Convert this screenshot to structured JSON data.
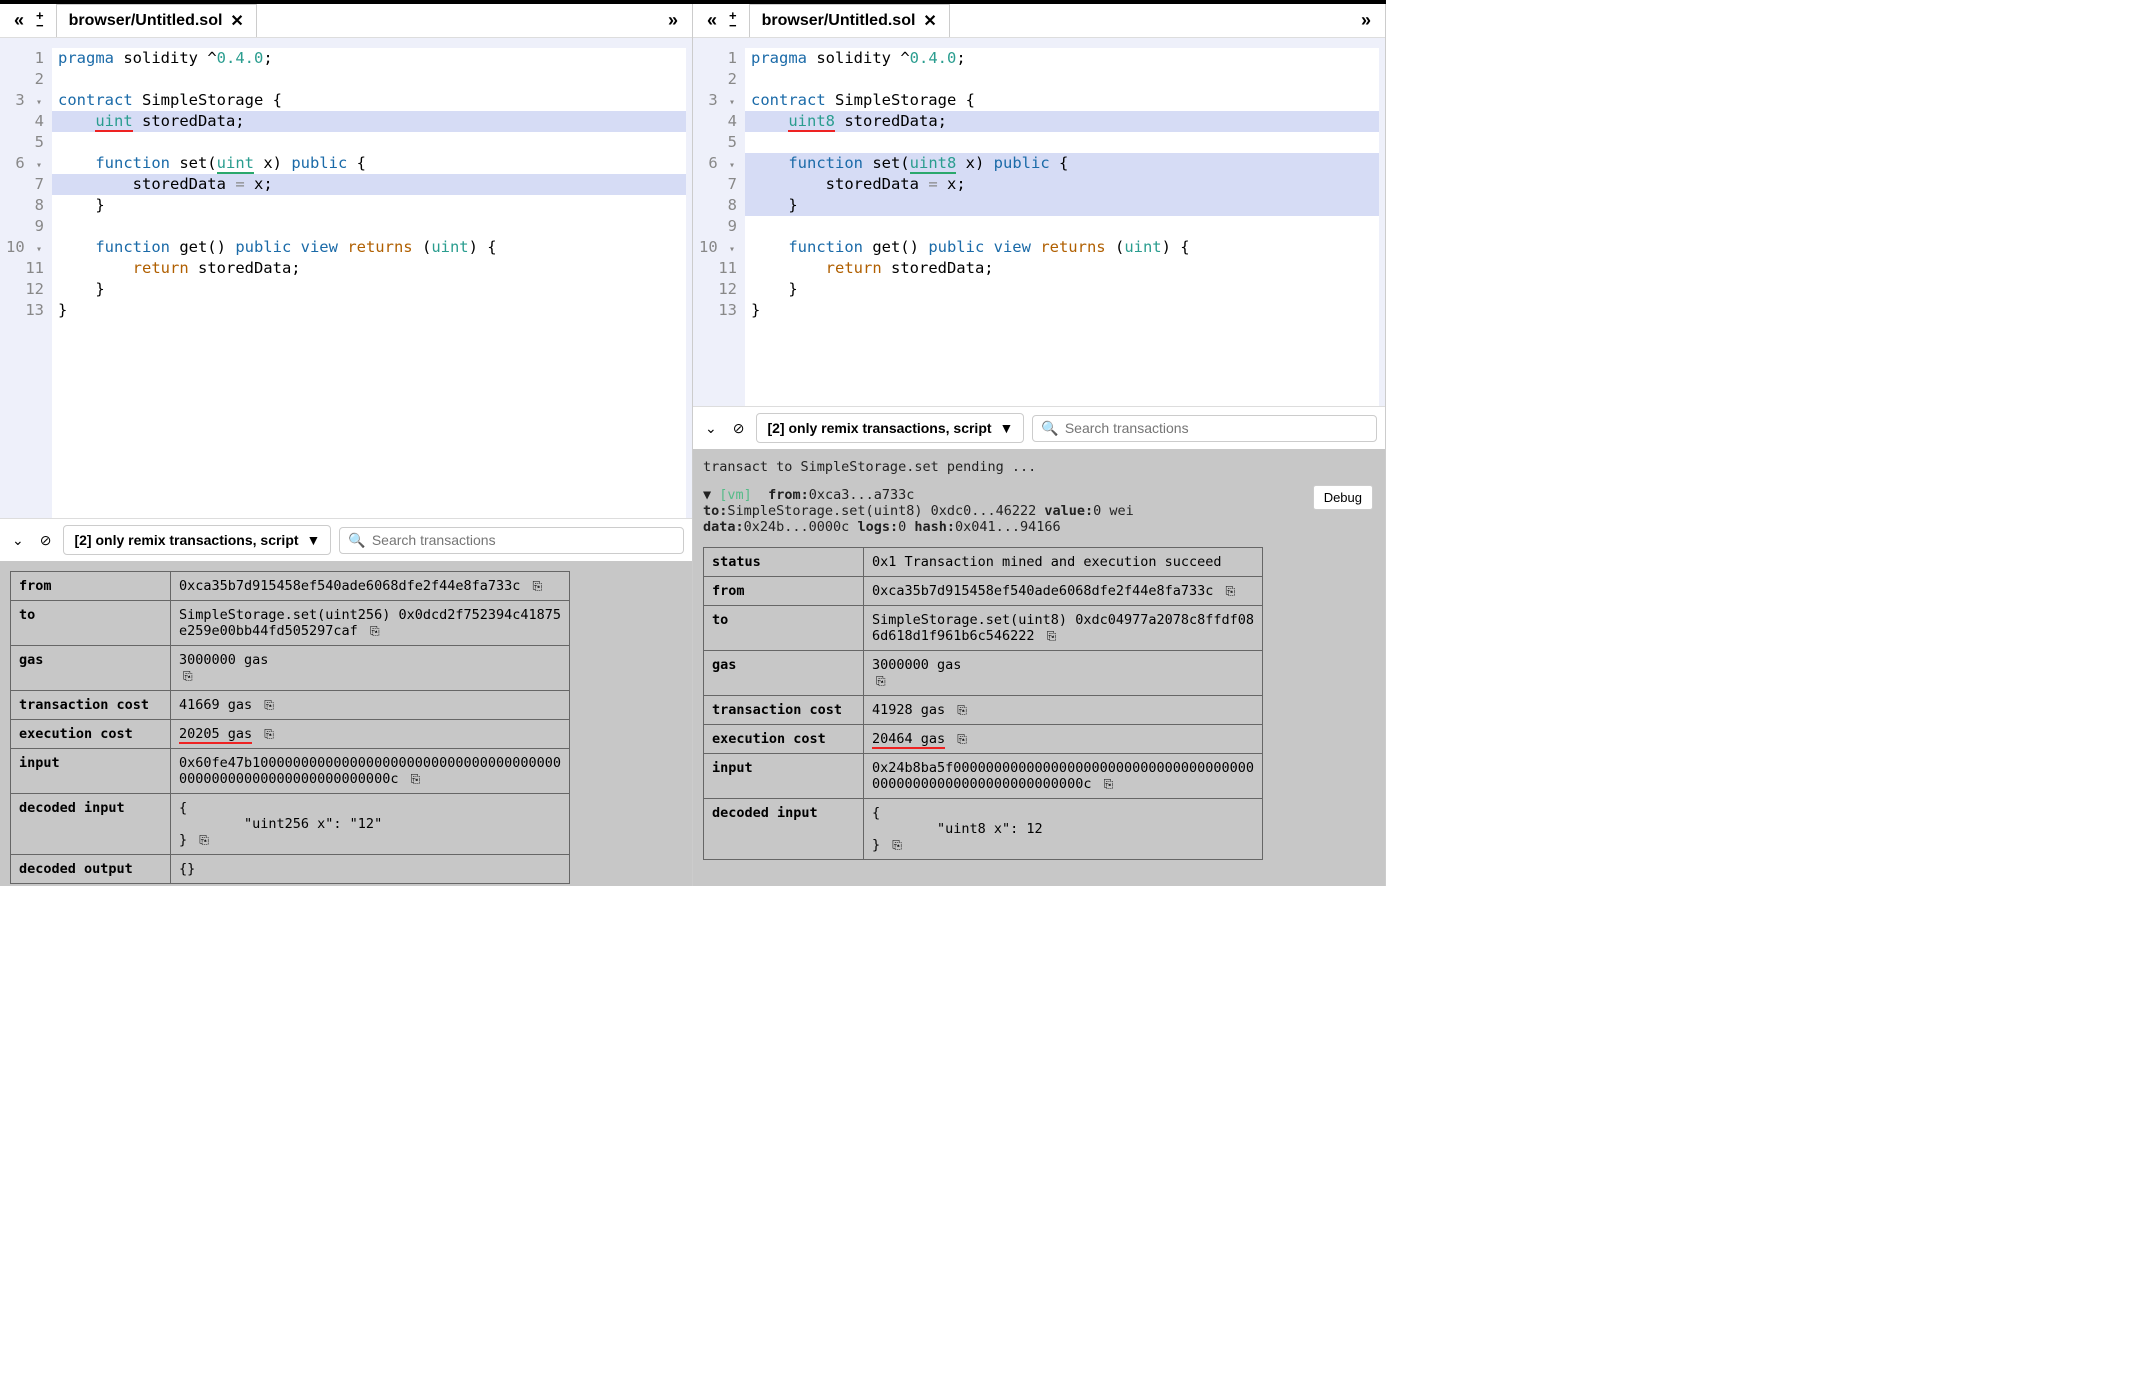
{
  "left": {
    "tabs": {
      "title": "browser/Untitled.sol"
    },
    "code": {
      "l1_a": "pragma",
      "l1_b": " solidity ^",
      "l1_c": "0.4.0",
      "l1_d": ";",
      "l3_a": "contract",
      "l3_b": " SimpleStorage {",
      "l4_a": "    ",
      "l4_b": "uint",
      "l4_c": " storedData;",
      "l6_a": "    ",
      "l6_b": "function",
      "l6_c": " set(",
      "l6_d": "uint",
      "l6_e": " x) ",
      "l6_f": "public",
      "l6_g": " {",
      "l7_a": "        storedData ",
      "l7_b": "=",
      "l7_c": " x;",
      "l8": "    }",
      "l10_a": "    ",
      "l10_b": "function",
      "l10_c": " get() ",
      "l10_d": "public view",
      "l10_e": " ",
      "l10_f": "returns",
      "l10_g": " (",
      "l10_h": "uint",
      "l10_i": ") {",
      "l11_a": "        ",
      "l11_b": "return",
      "l11_c": " storedData;",
      "l12": "    }",
      "l13": "}"
    },
    "console": {
      "select_label": "[2] only remix transactions, script",
      "search_placeholder": "Search transactions",
      "rows": {
        "from_k": "from",
        "from_v": "0xca35b7d915458ef540ade6068dfe2f44e8fa733c",
        "to_k": "to",
        "to_v": "SimpleStorage.set(uint256) 0x0dcd2f752394c41875e259e00bb44fd505297caf",
        "gas_k": "gas",
        "gas_v": "3000000 gas",
        "txcost_k": "transaction cost",
        "txcost_v": "41669 gas",
        "excost_k": "execution cost",
        "excost_v": "20205 gas",
        "input_k": "input",
        "input_v": "0x60fe47b1000000000000000000000000000000000000000000000000000000000000000c",
        "decin_k": "decoded input",
        "decin_v": "{\n        \"uint256 x\": \"12\"\n}",
        "decout_k": "decoded output",
        "decout_v": "{}"
      }
    }
  },
  "right": {
    "tabs": {
      "title": "browser/Untitled.sol"
    },
    "code": {
      "l1_a": "pragma",
      "l1_b": " solidity ^",
      "l1_c": "0.4.0",
      "l1_d": ";",
      "l3_a": "contract",
      "l3_b": " SimpleStorage {",
      "l4_a": "    ",
      "l4_b": "uint8",
      "l4_c": " storedData;",
      "l6_a": "    ",
      "l6_b": "function",
      "l6_c": " set(",
      "l6_d": "uint8",
      "l6_e": " x) ",
      "l6_f": "public",
      "l6_g": " {",
      "l7_a": "        storedData ",
      "l7_b": "=",
      "l7_c": " x;",
      "l8": "    }",
      "l10_a": "    ",
      "l10_b": "function",
      "l10_c": " get() ",
      "l10_d": "public view",
      "l10_e": " ",
      "l10_f": "returns",
      "l10_g": " (",
      "l10_h": "uint",
      "l10_i": ") {",
      "l11_a": "        ",
      "l11_b": "return",
      "l11_c": " storedData;",
      "l12": "    }",
      "l13": "}"
    },
    "console": {
      "select_label": "[2] only remix transactions, script",
      "search_placeholder": "Search transactions",
      "pending": "transact to SimpleStorage.set pending ...",
      "summary_vm": "[vm]",
      "summary_from_k": "from:",
      "summary_from_v": "0xca3...a733c",
      "summary_to_k": "to:",
      "summary_to_v": "SimpleStorage.set(uint8) 0xdc0...46222",
      "summary_val_k": "value:",
      "summary_val_v": "0 wei",
      "summary_data_k": "data:",
      "summary_data_v": "0x24b...0000c",
      "summary_logs_k": "logs:",
      "summary_logs_v": "0",
      "summary_hash_k": "hash:",
      "summary_hash_v": "0x041...94166",
      "debug": "Debug",
      "rows": {
        "status_k": "status",
        "status_v": "0x1 Transaction mined and execution succeed",
        "from_k": "from",
        "from_v": "0xca35b7d915458ef540ade6068dfe2f44e8fa733c",
        "to_k": "to",
        "to_v": "SimpleStorage.set(uint8) 0xdc04977a2078c8ffdf086d618d1f961b6c546222",
        "gas_k": "gas",
        "gas_v": "3000000 gas",
        "txcost_k": "transaction cost",
        "txcost_v": "41928 gas",
        "excost_k": "execution cost",
        "excost_v": "20464 gas",
        "input_k": "input",
        "input_v": "0x24b8ba5f000000000000000000000000000000000000000000000000000000000000000c",
        "decin_k": "decoded input",
        "decin_v": "{\n        \"uint8 x\": 12\n}"
      }
    }
  },
  "icons": {
    "copy": "⎘",
    "search": "🔍",
    "caret": "▼",
    "chev_down": "⌄",
    "chev_up": "⌃",
    "chev_left": "«",
    "chev_right": "»",
    "plus": "+",
    "minus": "−",
    "close": "✕",
    "ban": "⊘"
  }
}
